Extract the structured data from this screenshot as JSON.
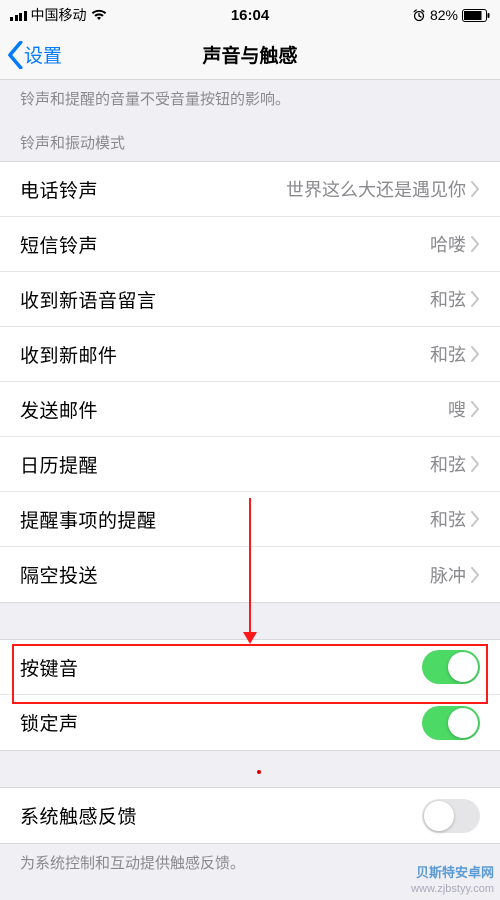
{
  "status": {
    "carrier": "中国移动",
    "time": "16:04",
    "battery_pct": "82%"
  },
  "nav": {
    "back": "设置",
    "title": "声音与触感"
  },
  "top_caption": "铃声和提醒的音量不受音量按钮的影响。",
  "section_header": "铃声和振动模式",
  "rows": [
    {
      "label": "电话铃声",
      "value": "世界这么大还是遇见你"
    },
    {
      "label": "短信铃声",
      "value": "哈喽"
    },
    {
      "label": "收到新语音留言",
      "value": "和弦"
    },
    {
      "label": "收到新邮件",
      "value": "和弦"
    },
    {
      "label": "发送邮件",
      "value": "嗖"
    },
    {
      "label": "日历提醒",
      "value": "和弦"
    },
    {
      "label": "提醒事项的提醒",
      "value": "和弦"
    },
    {
      "label": "隔空投送",
      "value": "脉冲"
    }
  ],
  "toggles": {
    "keyboard": {
      "label": "按键音",
      "on": true
    },
    "lock": {
      "label": "锁定声",
      "on": true
    }
  },
  "haptics": {
    "label": "系统触感反馈",
    "on": false
  },
  "footer_caption": "为系统控制和互动提供触感反馈。",
  "watermark": {
    "main": "贝斯特安卓网",
    "sub": "www.zjbstyy.com"
  }
}
